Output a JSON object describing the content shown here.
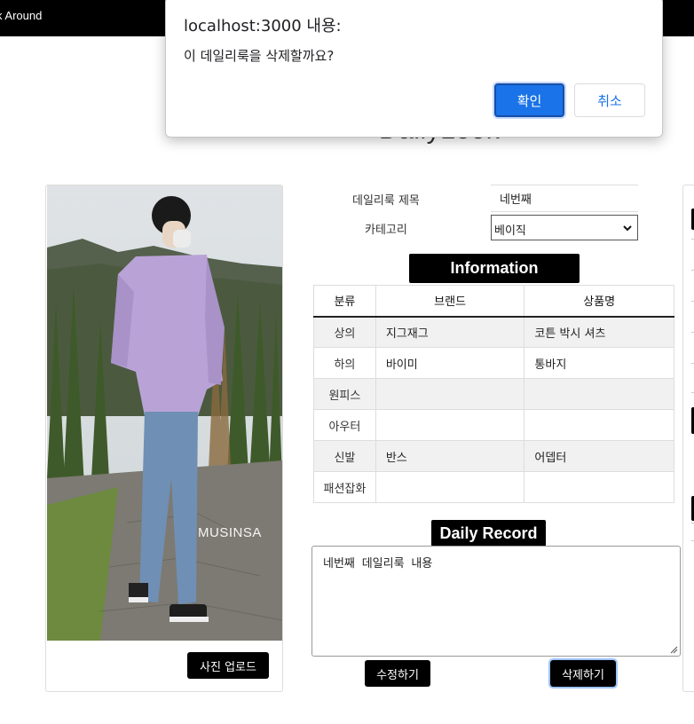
{
  "navbar": {
    "brand": "k Around"
  },
  "page": {
    "title": "DailyLook"
  },
  "photo": {
    "watermark": "MUSINSA",
    "upload_label": "사진 업로드"
  },
  "form": {
    "title_label": "데일리룩 제목",
    "title_value": "네번째",
    "category_label": "카테고리",
    "category_value": "베이직"
  },
  "info": {
    "heading": "Information",
    "headers": [
      "분류",
      "브랜드",
      "상품명"
    ],
    "rows": [
      {
        "category": "상의",
        "brand": "지그재그",
        "product": "코튼 박시 셔츠"
      },
      {
        "category": "하의",
        "brand": "바이미",
        "product": "통바지"
      },
      {
        "category": "원피스",
        "brand": "",
        "product": ""
      },
      {
        "category": "아우터",
        "brand": "",
        "product": ""
      },
      {
        "category": "신발",
        "brand": "반스",
        "product": "어뎁터"
      },
      {
        "category": "패션잡화",
        "brand": "",
        "product": ""
      }
    ]
  },
  "record": {
    "heading": "Daily Record",
    "content": "네번째 데일리룩 내용"
  },
  "actions": {
    "edit_label": "수정하기",
    "delete_label": "삭제하기"
  },
  "dialog": {
    "title": "localhost:3000 내용:",
    "message": "이 데일리룩을 삭제할까요?",
    "ok_label": "확인",
    "cancel_label": "취소"
  },
  "colors": {
    "navbar": "#000000",
    "accent": "#1a73e8",
    "badge": "#000000"
  }
}
